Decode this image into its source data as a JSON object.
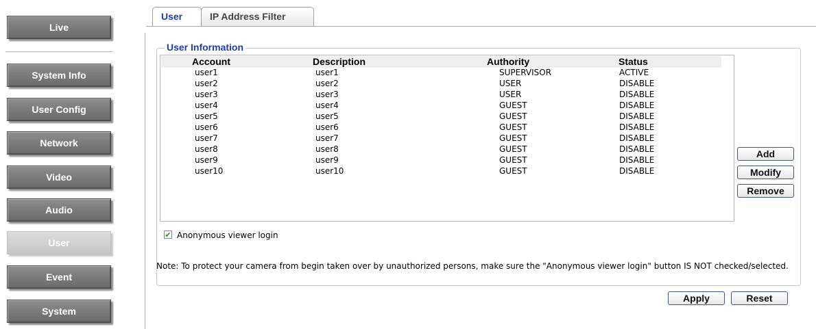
{
  "sidebar": {
    "items": [
      {
        "label": "Live"
      },
      {
        "label": "System Info"
      },
      {
        "label": "User Config"
      },
      {
        "label": "Network"
      },
      {
        "label": "Video"
      },
      {
        "label": "Audio"
      },
      {
        "label": "User",
        "active": true
      },
      {
        "label": "Event"
      },
      {
        "label": "System"
      }
    ]
  },
  "tabs": {
    "user": "User",
    "ip_filter": "IP Address Filter"
  },
  "user_info": {
    "legend": "User Information",
    "columns": {
      "account": "Account",
      "description": "Description",
      "authority": "Authority",
      "status": "Status"
    },
    "rows": [
      {
        "account": "user1",
        "description": "user1",
        "authority": "SUPERVISOR",
        "status": "ACTIVE"
      },
      {
        "account": "user2",
        "description": "user2",
        "authority": "USER",
        "status": "DISABLE"
      },
      {
        "account": "user3",
        "description": "user3",
        "authority": "USER",
        "status": "DISABLE"
      },
      {
        "account": "user4",
        "description": "user4",
        "authority": "GUEST",
        "status": "DISABLE"
      },
      {
        "account": "user5",
        "description": "user5",
        "authority": "GUEST",
        "status": "DISABLE"
      },
      {
        "account": "user6",
        "description": "user6",
        "authority": "GUEST",
        "status": "DISABLE"
      },
      {
        "account": "user7",
        "description": "user7",
        "authority": "GUEST",
        "status": "DISABLE"
      },
      {
        "account": "user8",
        "description": "user8",
        "authority": "GUEST",
        "status": "DISABLE"
      },
      {
        "account": "user9",
        "description": "user9",
        "authority": "GUEST",
        "status": "DISABLE"
      },
      {
        "account": "user10",
        "description": "user10",
        "authority": "GUEST",
        "status": "DISABLE"
      }
    ],
    "buttons": {
      "add": "Add",
      "modify": "Modify",
      "remove": "Remove"
    },
    "anonymous_login": {
      "label": "Anonymous viewer login",
      "checked": true
    },
    "note": "Note: To protect your camera from begin taken over by unauthorized persons, make sure the \"Anonymous viewer login\" button IS NOT checked/selected."
  },
  "footer": {
    "apply": "Apply",
    "reset": "Reset"
  },
  "colors": {
    "accent": "#1a3ea8",
    "nav_button": "#7d7d7d",
    "nav_active": "#d0d0d0"
  }
}
